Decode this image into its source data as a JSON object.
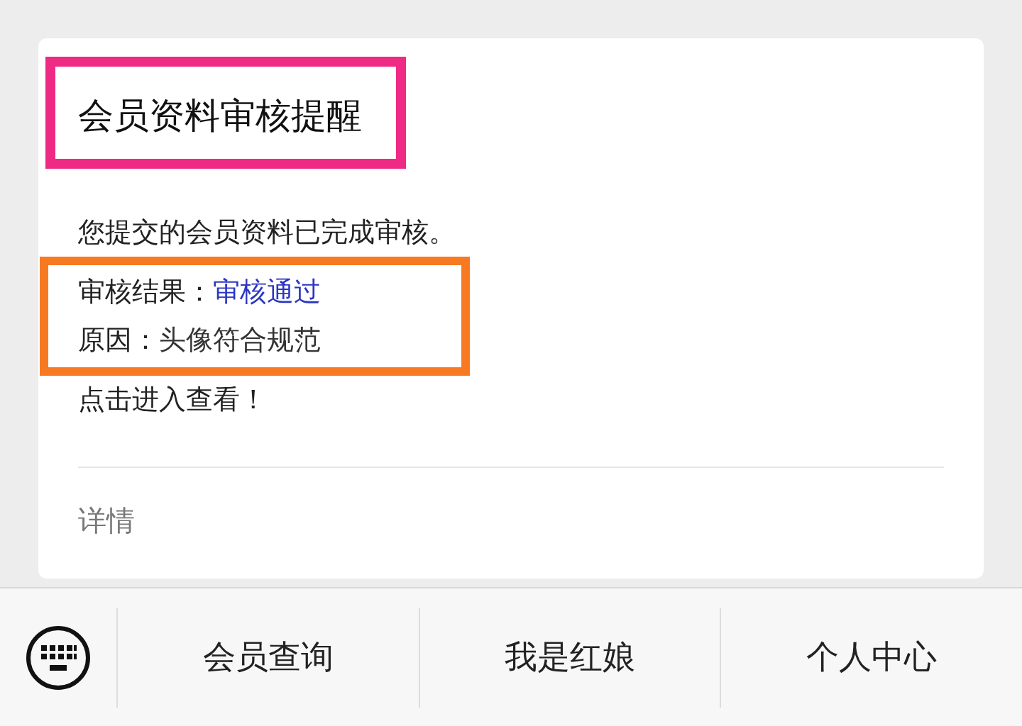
{
  "card": {
    "title": "会员资料审核提醒",
    "intro": "您提交的会员资料已完成审核。",
    "highlights": [
      {
        "color": "#ef2a85"
      },
      {
        "color": "#f77a23"
      }
    ],
    "fields": [
      {
        "label": "审核结果：",
        "value": "审核通过",
        "kind": "link"
      },
      {
        "label": "原因：",
        "value": "头像符合规范",
        "kind": "plain"
      }
    ],
    "outro": "点击进入查看！",
    "details": "详情"
  },
  "menu": {
    "items": [
      "会员查询",
      "我是红娘",
      "个人中心"
    ]
  }
}
